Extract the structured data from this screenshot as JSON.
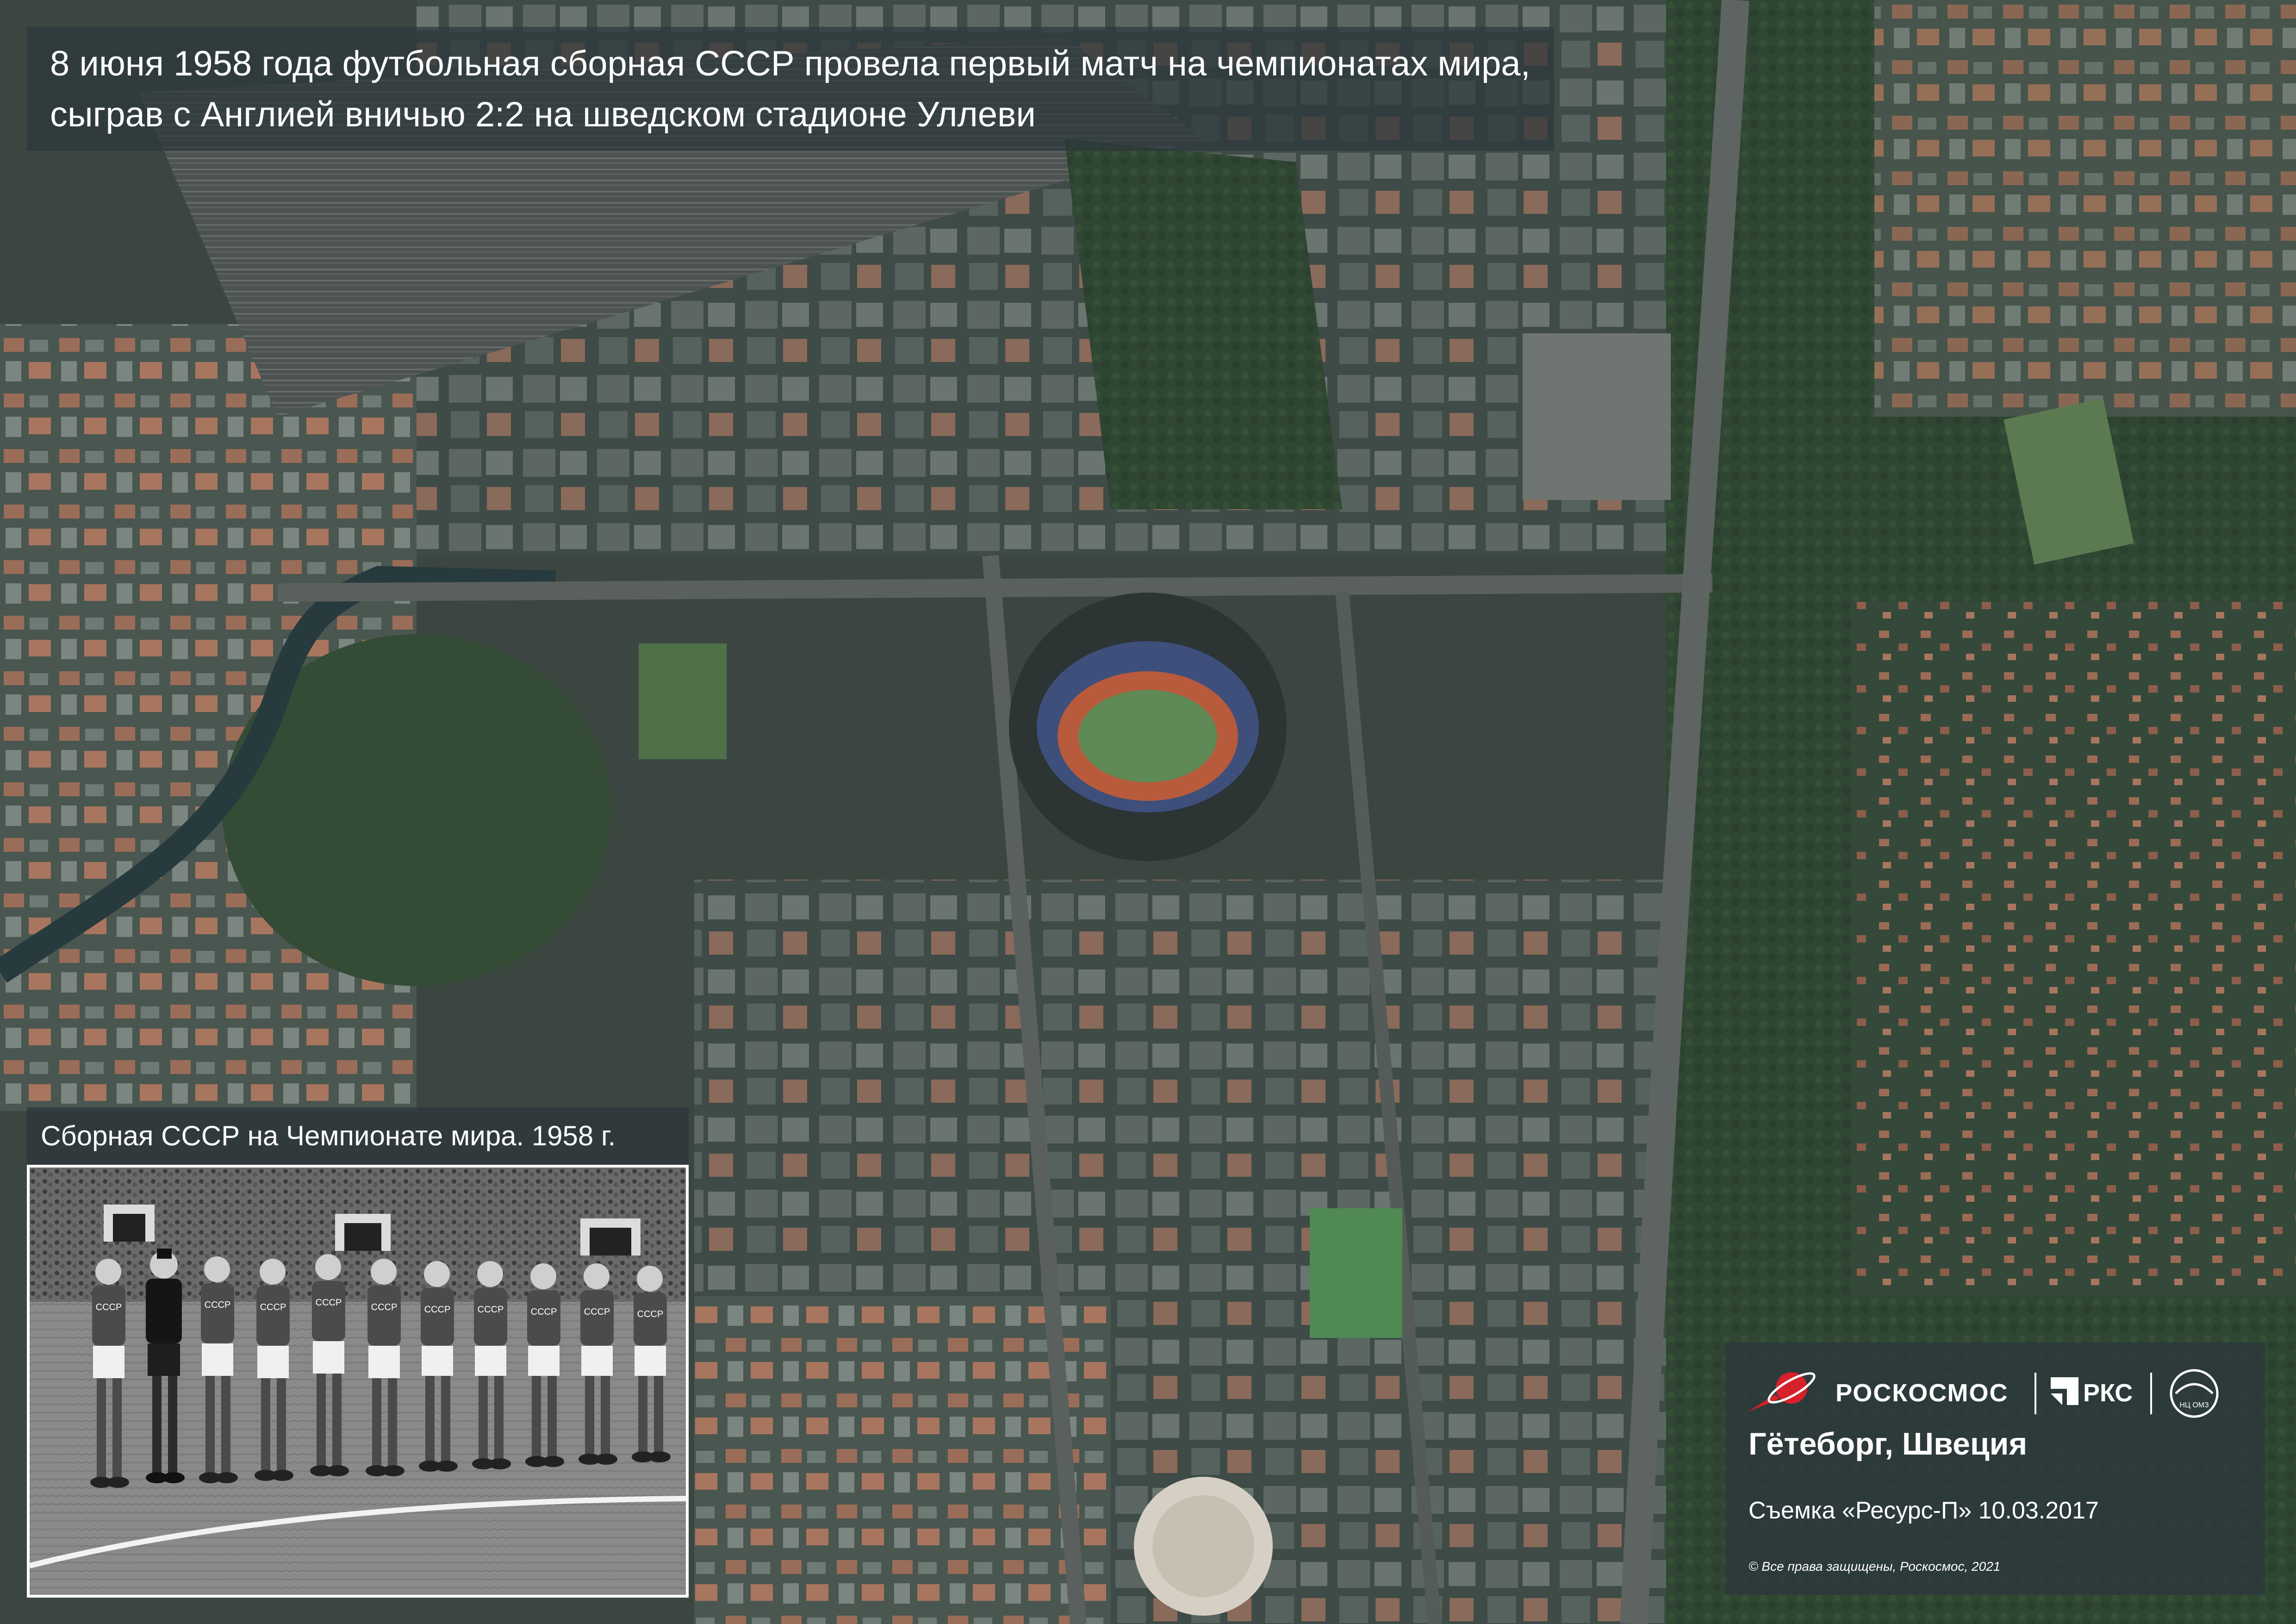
{
  "header": {
    "caption_line1": "8 июня 1958 года футбольная сборная СССР провела первый матч на чемпионатах мира,",
    "caption_line2": "сыграв с Англией вничью 2:2 на шведском стадионе Уллеви"
  },
  "photo": {
    "caption": "Сборная СССР на Чемпионате мира. 1958 г.",
    "jersey_text": "СССР"
  },
  "info": {
    "roscosmos_label": "РОСКОСМОС",
    "rks_label": "РКС",
    "nco_label": "НЦ ОМЗ",
    "location": "Гётеборг, Швеция",
    "survey": "Съемка «Ресурс-П» 10.03.2017",
    "copyright": "© Все права защищены, Роскосмос, 2021"
  },
  "colors": {
    "vegetation": "#2f4632",
    "urban": "#4a5650",
    "roof": "#a8765e",
    "pitch": "#5f8a55",
    "track": "#b85a3c",
    "water": "#273a3e",
    "panel": "#2d373c"
  }
}
